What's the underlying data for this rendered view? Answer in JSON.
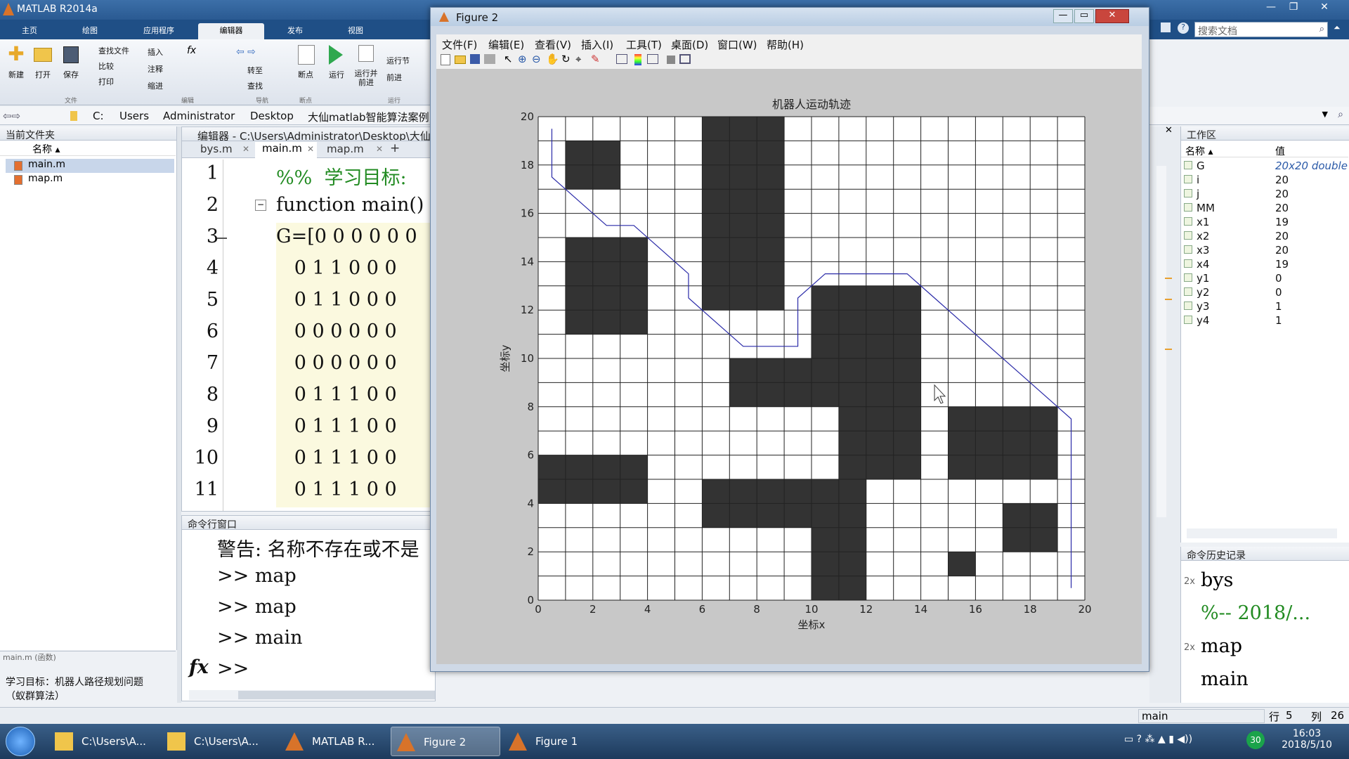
{
  "app": {
    "title": "MATLAB R2014a"
  },
  "tabs": [
    "主页",
    "绘图",
    "应用程序",
    "编辑器",
    "发布",
    "视图"
  ],
  "ribbon": {
    "buttons": [
      "新建",
      "打开",
      "保存",
      "断点",
      "运行",
      "运行并\n前进"
    ],
    "small": [
      "查找文件",
      "比较",
      "打印",
      "插入",
      "注释",
      "缩进",
      "转至",
      "查找",
      "运行节",
      "前进"
    ],
    "sections": [
      "文件",
      "编辑",
      "导航",
      "断点",
      "运行"
    ]
  },
  "search": {
    "placeholder": "搜索文档"
  },
  "address": {
    "path": [
      "C:",
      "Users",
      "Administrator",
      "Desktop",
      "大仙matlab智能算法案例"
    ]
  },
  "current_folder": {
    "title": "当前文件夹",
    "col_name": "名称 ▴",
    "files": [
      "main.m",
      "map.m"
    ],
    "detail_label": "main.m (函数)",
    "detail_text": "学习目标：机器人路径规划问题（蚁群算法）"
  },
  "editor": {
    "title": "编辑器 - C:\\Users\\Administrator\\Desktop\\大仙m",
    "tabs": [
      "bys.m",
      "main.m",
      "map.m"
    ],
    "lines": [
      {
        "n": "1",
        "code": "%%  学习目标:"
      },
      {
        "n": "2",
        "code": "function main()"
      },
      {
        "n": "3",
        "code": "G=[0 0 0 0 0 0"
      },
      {
        "n": "4",
        "code": "   0 1 1 0 0 0"
      },
      {
        "n": "5",
        "code": "   0 1 1 0 0 0"
      },
      {
        "n": "6",
        "code": "   0 0 0 0 0 0"
      },
      {
        "n": "7",
        "code": "   0 0 0 0 0 0"
      },
      {
        "n": "8",
        "code": "   0 1 1 1 0 0"
      },
      {
        "n": "9",
        "code": "   0 1 1 1 0 0"
      },
      {
        "n": "10",
        "code": "   0 1 1 1 0 0"
      },
      {
        "n": "11",
        "code": "   0 1 1 1 0 0"
      }
    ]
  },
  "command_window": {
    "title": "命令行窗口",
    "lines": [
      "警告: 名称不存在或不是",
      ">> map",
      ">> map",
      ">> main"
    ],
    "prompt": ">>",
    "fx": "fx"
  },
  "workspace": {
    "title": "工作区",
    "col_name": "名称 ▴",
    "col_value": "值",
    "vars": [
      {
        "name": "G",
        "value": "20x20 double"
      },
      {
        "name": "i",
        "value": "20"
      },
      {
        "name": "j",
        "value": "20"
      },
      {
        "name": "MM",
        "value": "20"
      },
      {
        "name": "x1",
        "value": "19"
      },
      {
        "name": "x2",
        "value": "20"
      },
      {
        "name": "x3",
        "value": "20"
      },
      {
        "name": "x4",
        "value": "19"
      },
      {
        "name": "y1",
        "value": "0"
      },
      {
        "name": "y2",
        "value": "0"
      },
      {
        "name": "y3",
        "value": "1"
      },
      {
        "name": "y4",
        "value": "1"
      }
    ]
  },
  "history": {
    "title": "命令历史记录",
    "items": [
      {
        "count": "2x",
        "text": "bys"
      },
      {
        "count": "",
        "text": "%-- 2018/..."
      },
      {
        "count": "2x",
        "text": "map"
      },
      {
        "count": "",
        "text": "main"
      }
    ]
  },
  "status": {
    "func": "main",
    "row_label": "行",
    "row": "5",
    "col_label": "列",
    "col": "26"
  },
  "figure": {
    "title": "Figure 2",
    "menu": [
      "文件(F)",
      "编辑(E)",
      "查看(V)",
      "插入(I)",
      "工具(T)",
      "桌面(D)",
      "窗口(W)",
      "帮助(H)"
    ]
  },
  "chart_data": {
    "type": "heatmap",
    "title": "机器人运动轨迹",
    "xlabel": "坐标x",
    "ylabel": "坐标y",
    "xlim": [
      0,
      20
    ],
    "ylim": [
      0,
      20
    ],
    "xticks": [
      0,
      2,
      4,
      6,
      8,
      10,
      12,
      14,
      16,
      18,
      20
    ],
    "yticks": [
      0,
      2,
      4,
      6,
      8,
      10,
      12,
      14,
      16,
      18,
      20
    ],
    "grid": [
      [
        0,
        0,
        0,
        0,
        0,
        0,
        1,
        1,
        1,
        0,
        0,
        0,
        0,
        0,
        0,
        0,
        0,
        0,
        0,
        0
      ],
      [
        0,
        1,
        1,
        0,
        0,
        0,
        1,
        1,
        1,
        0,
        0,
        0,
        0,
        0,
        0,
        0,
        0,
        0,
        0,
        0
      ],
      [
        0,
        1,
        1,
        0,
        0,
        0,
        1,
        1,
        1,
        0,
        0,
        0,
        0,
        0,
        0,
        0,
        0,
        0,
        0,
        0
      ],
      [
        0,
        0,
        0,
        0,
        0,
        0,
        1,
        1,
        1,
        0,
        0,
        0,
        0,
        0,
        0,
        0,
        0,
        0,
        0,
        0
      ],
      [
        0,
        0,
        0,
        0,
        0,
        0,
        1,
        1,
        1,
        0,
        0,
        0,
        0,
        0,
        0,
        0,
        0,
        0,
        0,
        0
      ],
      [
        0,
        1,
        1,
        1,
        0,
        0,
        1,
        1,
        1,
        0,
        0,
        0,
        0,
        0,
        0,
        0,
        0,
        0,
        0,
        0
      ],
      [
        0,
        1,
        1,
        1,
        0,
        0,
        1,
        1,
        1,
        0,
        0,
        0,
        0,
        0,
        0,
        0,
        0,
        0,
        0,
        0
      ],
      [
        0,
        1,
        1,
        1,
        0,
        0,
        1,
        1,
        1,
        0,
        1,
        1,
        1,
        1,
        0,
        0,
        0,
        0,
        0,
        0
      ],
      [
        0,
        1,
        1,
        1,
        0,
        0,
        0,
        0,
        0,
        0,
        1,
        1,
        1,
        1,
        0,
        0,
        0,
        0,
        0,
        0
      ],
      [
        0,
        0,
        0,
        0,
        0,
        0,
        0,
        0,
        0,
        0,
        1,
        1,
        1,
        1,
        0,
        0,
        0,
        0,
        0,
        0
      ],
      [
        0,
        0,
        0,
        0,
        0,
        0,
        0,
        1,
        1,
        1,
        1,
        1,
        1,
        1,
        0,
        0,
        0,
        0,
        0,
        0
      ],
      [
        0,
        0,
        0,
        0,
        0,
        0,
        0,
        1,
        1,
        1,
        1,
        1,
        1,
        1,
        0,
        0,
        0,
        0,
        0,
        0
      ],
      [
        0,
        0,
        0,
        0,
        0,
        0,
        0,
        0,
        0,
        0,
        0,
        1,
        1,
        1,
        0,
        1,
        1,
        1,
        1,
        0
      ],
      [
        0,
        0,
        0,
        0,
        0,
        0,
        0,
        0,
        0,
        0,
        0,
        1,
        1,
        1,
        0,
        1,
        1,
        1,
        1,
        0
      ],
      [
        1,
        1,
        1,
        1,
        0,
        0,
        0,
        0,
        0,
        0,
        0,
        1,
        1,
        1,
        0,
        1,
        1,
        1,
        1,
        0
      ],
      [
        1,
        1,
        1,
        1,
        0,
        0,
        1,
        1,
        1,
        1,
        1,
        1,
        0,
        0,
        0,
        0,
        0,
        0,
        0,
        0
      ],
      [
        0,
        0,
        0,
        0,
        0,
        0,
        1,
        1,
        1,
        1,
        1,
        1,
        0,
        0,
        0,
        0,
        0,
        1,
        1,
        0
      ],
      [
        0,
        0,
        0,
        0,
        0,
        0,
        0,
        0,
        0,
        0,
        1,
        1,
        0,
        0,
        0,
        0,
        0,
        1,
        1,
        0
      ],
      [
        0,
        0,
        0,
        0,
        0,
        0,
        0,
        0,
        0,
        0,
        1,
        1,
        0,
        0,
        0,
        1,
        0,
        0,
        0,
        0
      ],
      [
        0,
        0,
        0,
        0,
        0,
        0,
        0,
        0,
        0,
        0,
        1,
        1,
        0,
        0,
        0,
        0,
        0,
        0,
        0,
        0
      ]
    ],
    "series": [
      {
        "color": "#2a2aa8",
        "x": [
          0.5,
          0.5,
          1.5,
          2.5,
          3.5,
          4.5,
          5.5,
          5.5,
          6.5,
          7.5,
          8.5,
          9.5,
          9.5,
          10.5,
          11.5,
          12.5,
          13.5,
          14.5,
          15.5,
          16.5,
          17.5,
          18.5,
          19.5,
          19.5
        ],
        "y": [
          19.5,
          17.5,
          16.5,
          15.5,
          15.5,
          14.5,
          13.5,
          12.5,
          11.5,
          10.5,
          10.5,
          10.5,
          12.5,
          13.5,
          13.5,
          13.5,
          13.5,
          12.5,
          11.5,
          10.5,
          9.5,
          8.5,
          7.5,
          0.5
        ]
      }
    ]
  },
  "taskbar": {
    "items": [
      "C:\\Users\\A...",
      "C:\\Users\\A...",
      "MATLAB R...",
      "Figure 2",
      "Figure 1"
    ],
    "time": "16:03",
    "date": "2018/5/10",
    "badge": "30"
  },
  "colors": {
    "accent": "#1f4f86",
    "obstacle": "#333333",
    "path": "#2a2aa8"
  }
}
